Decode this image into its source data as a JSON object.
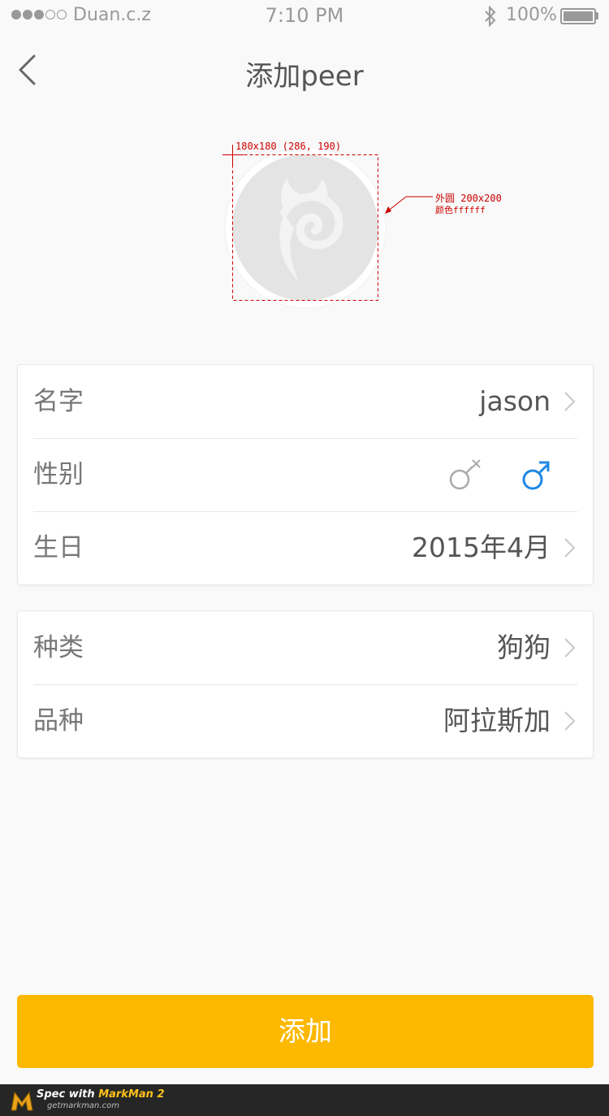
{
  "status_bar": {
    "carrier": "Duan.c.z",
    "time": "7:10 PM",
    "battery": "100%",
    "signal_bars": 3,
    "signal_total": 5
  },
  "nav": {
    "title": "添加peer",
    "back_icon": "chevron-left-icon"
  },
  "avatar": {
    "placeholder_icon": "snail-logo-icon",
    "annotation_size": "180x180 (286, 190)",
    "annotation_outer_line1": "外圆 200x200",
    "annotation_outer_line2": "颜色ffffff",
    "outer_color": "#ffffff",
    "inner_color": "#e4e4e4"
  },
  "profile": {
    "name_label": "名字",
    "name_value": "jason",
    "gender_label": "性别",
    "gender_icons": [
      "male-unselected-icon",
      "male-selected-icon"
    ],
    "birthday_label": "生日",
    "birthday_value": "2015年4月"
  },
  "pet": {
    "kind_label": "种类",
    "kind_value": "狗狗",
    "breed_label": "品种",
    "breed_value": "阿拉斯加"
  },
  "actions": {
    "add_label": "添加"
  },
  "footer": {
    "title_prefix": "Spec with ",
    "title_brand": "MarkMan 2",
    "subtitle": "getmarkman.com"
  },
  "colors": {
    "accent": "#fdb800",
    "selected_blue": "#1e88e5",
    "annotation_red": "#cc0000",
    "background": "#f9f9f9"
  }
}
